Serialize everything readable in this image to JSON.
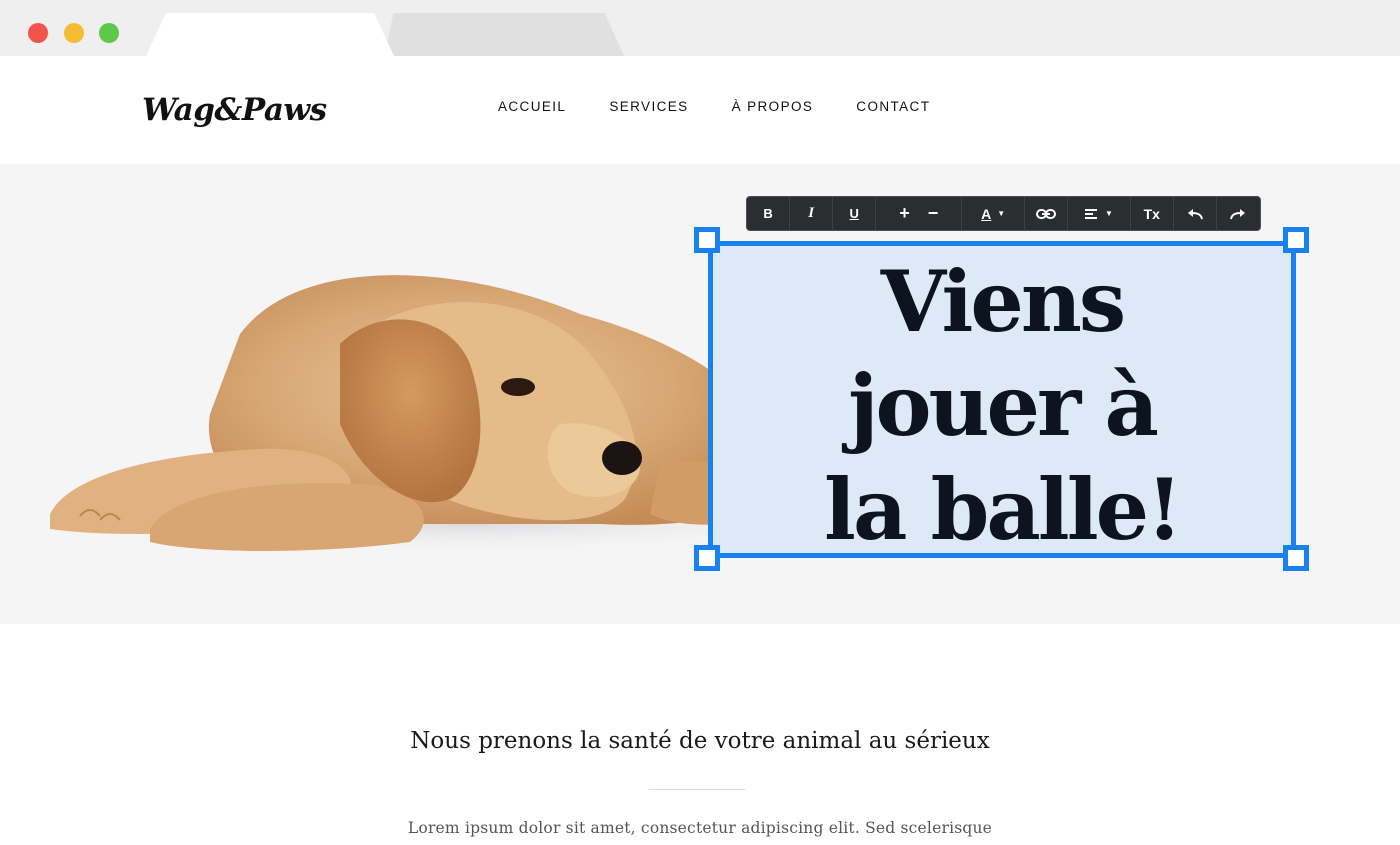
{
  "browser": {
    "window_controls": [
      "close",
      "minimize",
      "maximize"
    ]
  },
  "site": {
    "logo": "Wag&Paws",
    "nav": [
      "ACCUEIL",
      "SERVICES",
      "À PROPOS",
      "CONTACT"
    ]
  },
  "editor": {
    "headline_lines": [
      "Viens",
      "jouer à",
      "la balle!"
    ],
    "toolbar": {
      "bold": "B",
      "italic": "I",
      "underline": "U",
      "increase": "+",
      "decrease": "−",
      "text_color": "A",
      "link_icon": "link-icon",
      "align_icon": "align-left-icon",
      "clear_format": "Tx",
      "undo_icon": "undo-icon",
      "redo_icon": "redo-icon"
    },
    "accent_color": "#1a82f0"
  },
  "content": {
    "title": "Nous prenons la santé de votre animal au sérieux",
    "body": "Lorem ipsum dolor sit amet, consectetur adipiscing elit. Sed scelerisque"
  }
}
